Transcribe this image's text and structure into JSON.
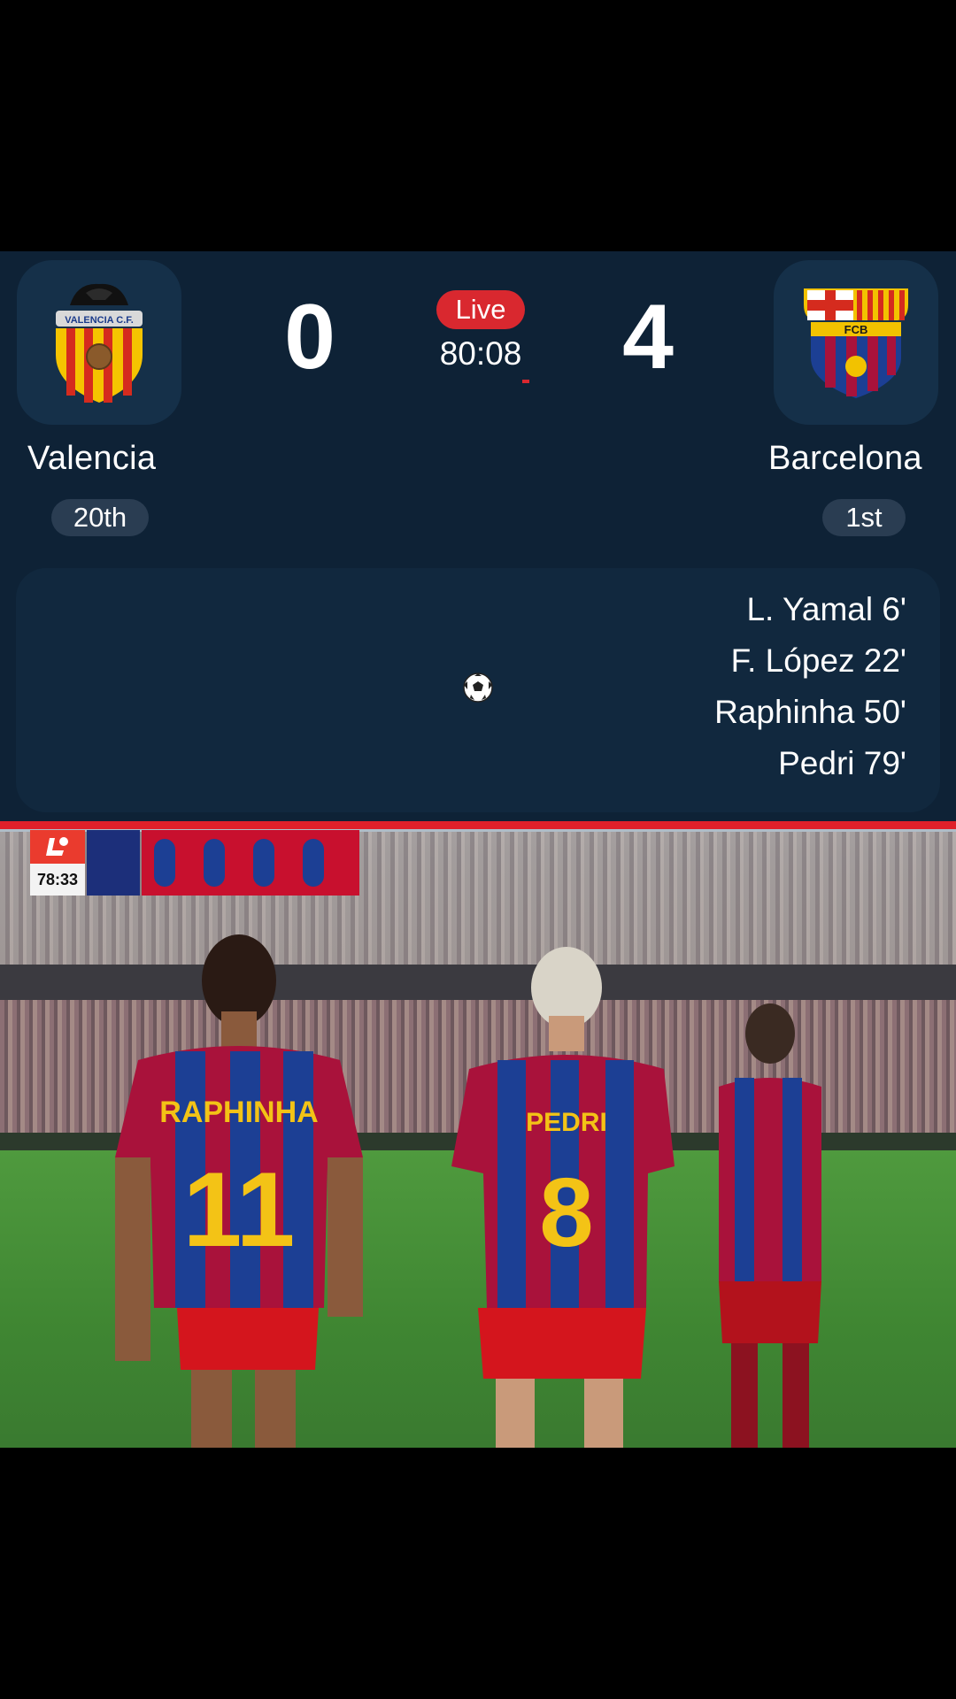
{
  "match": {
    "status": "Live",
    "clock": "80:08",
    "home": {
      "name": "Valencia",
      "rank": "20th",
      "score": "0",
      "crest_text": "VALENCIA C.F."
    },
    "away": {
      "name": "Barcelona",
      "rank": "1st",
      "score": "4",
      "crest_text": "FCB"
    }
  },
  "scorers": {
    "home": [],
    "away": [
      {
        "text": "L. Yamal 6'"
      },
      {
        "text": "F. López 22'"
      },
      {
        "text": "Raphinha 50'"
      },
      {
        "text": "Pedri 79'"
      }
    ]
  },
  "video": {
    "broadcast_clock": "78:33",
    "players": [
      {
        "name": "RAPHINHA",
        "number": "11"
      },
      {
        "name": "PEDRI",
        "number": "8"
      }
    ]
  },
  "colors": {
    "card_bg": "#0e2236",
    "live_red": "#d9282f",
    "badge_bg": "#2a3d52",
    "barca_blue": "#1c3f94",
    "barca_red": "#a9123b"
  },
  "icons": [
    "valencia-crest",
    "barcelona-crest",
    "soccer-ball-icon",
    "laliga-logo"
  ]
}
